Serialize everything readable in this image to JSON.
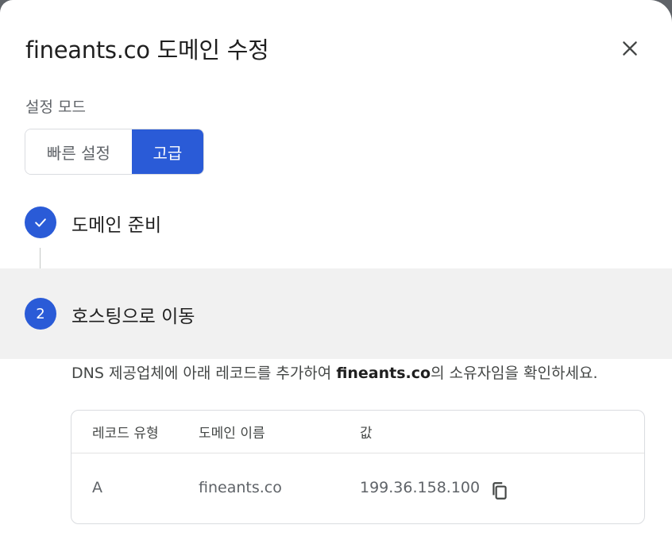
{
  "dialog": {
    "title": "fineants.co 도메인 수정",
    "close_icon": "close-icon"
  },
  "mode": {
    "label": "설정 모드",
    "options": [
      "빠른 설정",
      "고급"
    ],
    "selected": "고급"
  },
  "steps": [
    {
      "marker": "check-icon",
      "title": "도메인 준비",
      "status": "completed"
    },
    {
      "marker": "2",
      "title": "호스팅으로 이동",
      "status": "active"
    }
  ],
  "instructions": {
    "prefix": "DNS 제공업체에 아래 레코드를 추가하여 ",
    "domain": "fineants.co",
    "suffix": "의 소유자임을 확인하세요."
  },
  "record_table": {
    "headers": [
      "레코드 유형",
      "도메인 이름",
      "값"
    ],
    "rows": [
      {
        "type": "A",
        "name": "fineants.co",
        "value": "199.36.158.100",
        "action_icon": "copy-icon"
      }
    ]
  },
  "colors": {
    "accent": "#2a5bd7",
    "active_step_bg": "#f1f1f1",
    "text_primary": "#1f1f1f",
    "text_secondary": "#5f6368"
  }
}
